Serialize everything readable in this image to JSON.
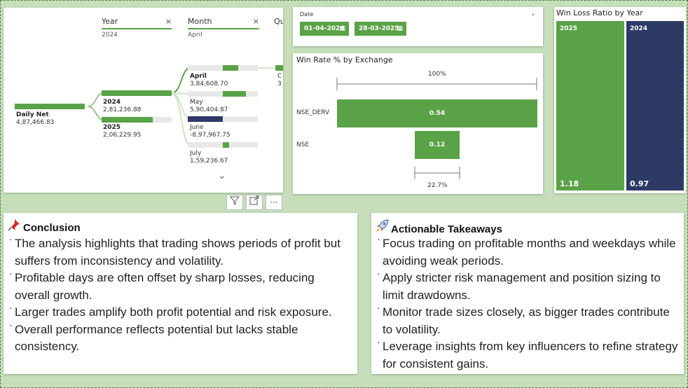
{
  "tree": {
    "year_header": "Year",
    "year_value": "2024",
    "month_header": "Month",
    "month_value": "April",
    "third_header": "Qu",
    "root": {
      "name": "Daily Net",
      "value": "4,87,466.83"
    },
    "years": [
      {
        "name": "2024",
        "value": "2,81,236.88"
      },
      {
        "name": "2025",
        "value": "2,06,229.95"
      }
    ],
    "months": [
      {
        "name": "April",
        "value": "3,84,608.70"
      },
      {
        "name": "May",
        "value": "5,90,404.87"
      },
      {
        "name": "June",
        "value": "-8,97,967.75"
      },
      {
        "name": "July",
        "value": "1,59,236.67"
      }
    ],
    "cut_node": {
      "name": "C",
      "value": "3"
    }
  },
  "date": {
    "label": "Date",
    "start": "01-04-2024",
    "end": "28-03-2025"
  },
  "winrate": {
    "title": "Win Rate % by Exchange",
    "top_pct": "100%",
    "bottom_pct": "22.7%",
    "rows": [
      {
        "label": "NSE_DERV",
        "value": "0.54"
      },
      {
        "label": "NSE",
        "value": "0.12"
      }
    ]
  },
  "winloss": {
    "title": "Win Loss Ratio by Year",
    "years": [
      {
        "year": "2025",
        "value": "1.18"
      },
      {
        "year": "2024",
        "value": "0.97"
      }
    ]
  },
  "colors": {
    "green": "#5aa247",
    "navy": "#2d3a66"
  },
  "conclusion": {
    "title": "Conclusion",
    "icon": "pushpin-icon",
    "items": [
      "The analysis highlights that trading shows periods of profit but suffers from inconsistency and volatility.",
      "Profitable days are often offset by sharp losses, reducing overall growth.",
      "Larger trades amplify both profit potential and risk exposure.",
      "Overall performance reflects potential but lacks stable consistency."
    ]
  },
  "takeaways": {
    "title": "Actionable Takeaways",
    "icon": "rocket-icon",
    "items": [
      "Focus trading on profitable months and weekdays while avoiding weak periods.",
      "Apply stricter risk management and position sizing to limit drawdowns.",
      "Monitor trade sizes closely, as bigger trades contribute to volatility.",
      "Leverage insights from key influencers to refine strategy for consistent gains."
    ]
  }
}
